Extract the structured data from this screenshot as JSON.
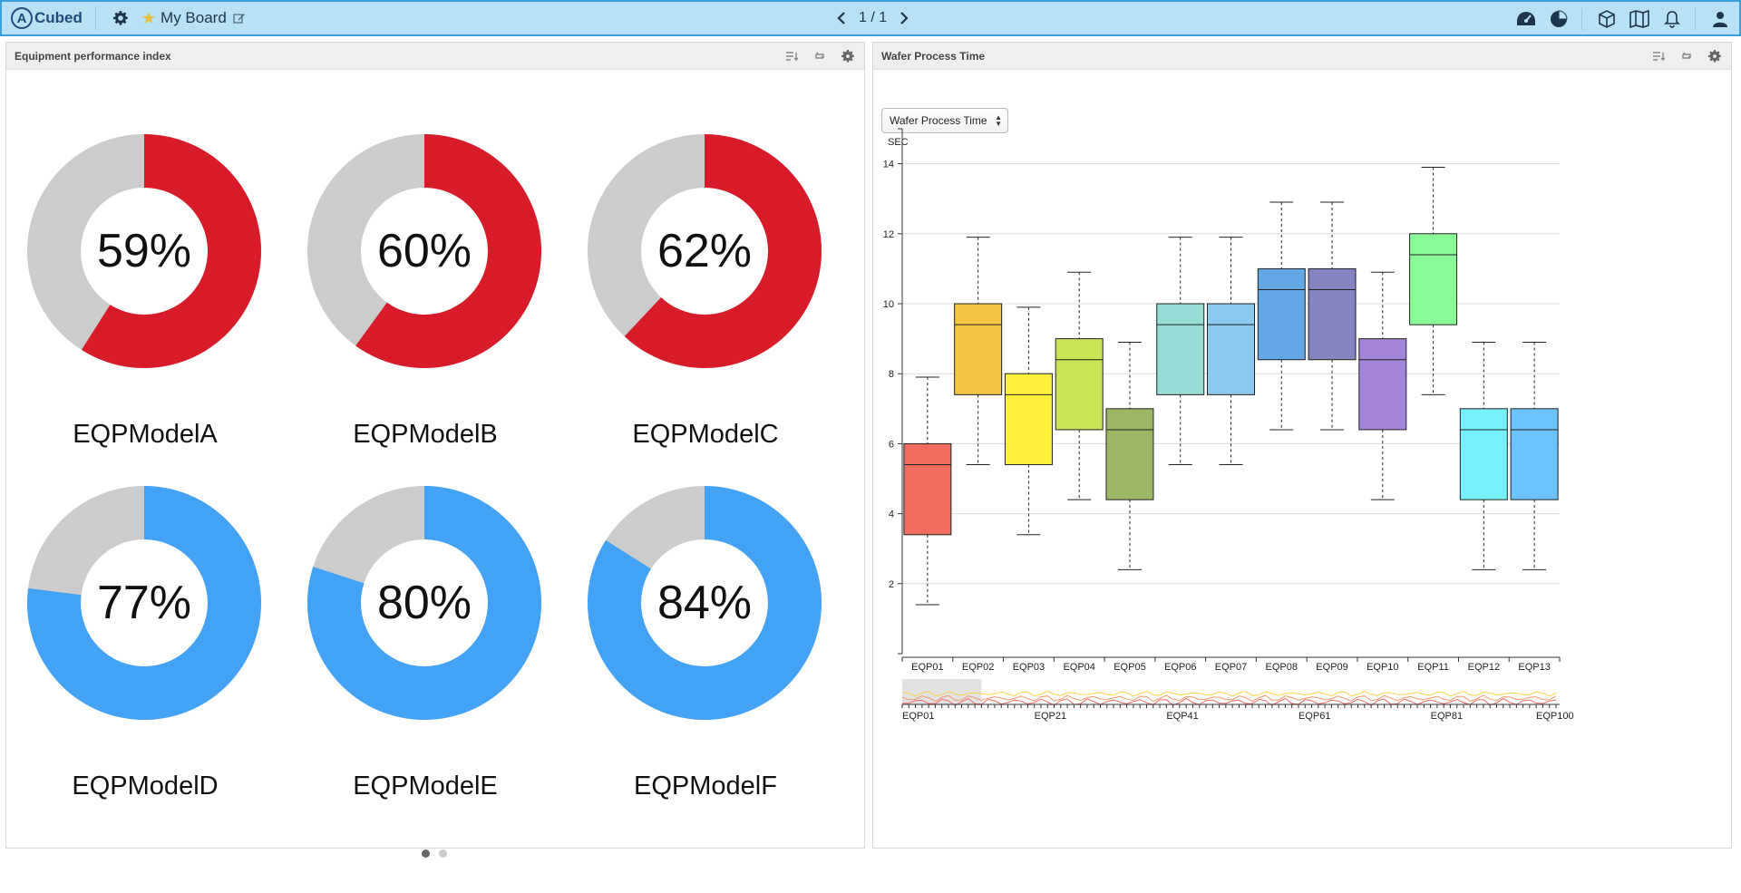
{
  "app": {
    "logo_letter": "A",
    "logo_text": "Cubed"
  },
  "board": {
    "title": "My Board"
  },
  "pager": {
    "text": "1 / 1"
  },
  "icons": {
    "settings": "gear-icon",
    "favorite": "star-icon",
    "edit": "pencil-edit-icon",
    "prev": "chevron-left-icon",
    "next": "chevron-right-icon",
    "dashboard": "dashboard-gauge-icon",
    "pie": "pie-chart-icon",
    "cube": "cube-icon",
    "map": "map-icon",
    "notifications": "bell-icon",
    "user": "user-icon"
  },
  "left_panel": {
    "title": "Equipment performance index",
    "models": [
      {
        "name": "EQPModelA",
        "percent": 59,
        "label": "59%",
        "color": "#d81b29"
      },
      {
        "name": "EQPModelB",
        "percent": 60,
        "label": "60%",
        "color": "#d81b29"
      },
      {
        "name": "EQPModelC",
        "percent": 62,
        "label": "62%",
        "color": "#d81b29"
      },
      {
        "name": "EQPModelD",
        "percent": 77,
        "label": "77%",
        "color": "#42a2f5"
      },
      {
        "name": "EQPModelE",
        "percent": 80,
        "label": "80%",
        "color": "#42a2f5"
      },
      {
        "name": "EQPModelF",
        "percent": 84,
        "label": "84%",
        "color": "#42a2f5"
      }
    ],
    "remainder_color": "#cccccc",
    "page_dots": {
      "count": 2,
      "active": 0
    }
  },
  "right_panel": {
    "title": "Wafer Process Time",
    "select": {
      "value": "Wafer Process Time"
    },
    "chart_data": {
      "type": "boxplot",
      "ylabel": "SEC",
      "ylim": [
        0,
        15
      ],
      "yticks": [
        2,
        4,
        6,
        8,
        10,
        12,
        14
      ],
      "grid": true,
      "categories": [
        "EQP01",
        "EQP02",
        "EQP03",
        "EQP04",
        "EQP05",
        "EQP06",
        "EQP07",
        "EQP08",
        "EQP09",
        "EQP10",
        "EQP11",
        "EQP12",
        "EQP13"
      ],
      "boxes": [
        {
          "min": 1.4,
          "q1": 3.4,
          "median": 5.4,
          "q3": 6.0,
          "max": 7.9,
          "color": "#ef6b5d"
        },
        {
          "min": 5.4,
          "q1": 7.4,
          "median": 9.4,
          "q3": 10.0,
          "max": 11.9,
          "color": "#f4c542"
        },
        {
          "min": 3.4,
          "q1": 5.4,
          "median": 7.4,
          "q3": 8.0,
          "max": 9.9,
          "color": "#fcf03d"
        },
        {
          "min": 4.4,
          "q1": 6.4,
          "median": 8.4,
          "q3": 9.0,
          "max": 10.9,
          "color": "#c9e455"
        },
        {
          "min": 2.4,
          "q1": 4.4,
          "median": 6.4,
          "q3": 7.0,
          "max": 8.9,
          "color": "#9bb765"
        },
        {
          "min": 5.4,
          "q1": 7.4,
          "median": 9.4,
          "q3": 10.0,
          "max": 11.9,
          "color": "#98dcd6"
        },
        {
          "min": 5.4,
          "q1": 7.4,
          "median": 9.4,
          "q3": 10.0,
          "max": 11.9,
          "color": "#8dc9ee"
        },
        {
          "min": 6.4,
          "q1": 8.4,
          "median": 10.4,
          "q3": 11.0,
          "max": 12.9,
          "color": "#63a7e5"
        },
        {
          "min": 6.4,
          "q1": 8.4,
          "median": 10.4,
          "q3": 11.0,
          "max": 12.9,
          "color": "#8584c0"
        },
        {
          "min": 4.4,
          "q1": 6.4,
          "median": 8.4,
          "q3": 9.0,
          "max": 10.9,
          "color": "#a285d9"
        },
        {
          "min": 7.4,
          "q1": 9.4,
          "median": 11.4,
          "q3": 12.0,
          "max": 13.9,
          "color": "#89fa98"
        },
        {
          "min": 2.4,
          "q1": 4.4,
          "median": 6.4,
          "q3": 7.0,
          "max": 8.9,
          "color": "#76f1fb"
        },
        {
          "min": 2.4,
          "q1": 4.4,
          "median": 6.4,
          "q3": 7.0,
          "max": 8.9,
          "color": "#6cc3fb"
        }
      ],
      "navigator": {
        "labels": [
          "EQP01",
          "EQP21",
          "EQP41",
          "EQP61",
          "EQP81",
          "EQP100"
        ],
        "count": 100,
        "selection": [
          1,
          13
        ]
      }
    }
  }
}
